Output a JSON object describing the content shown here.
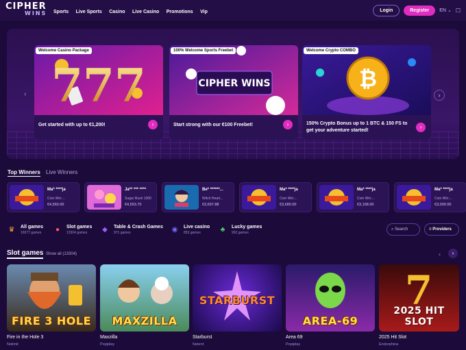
{
  "header": {
    "logo_line1": "CIPHER",
    "logo_line2": "WINS",
    "nav": [
      "Sports",
      "Live Sports",
      "Casino",
      "Live Casino",
      "Promotions",
      "Vip"
    ],
    "login_label": "Login",
    "register_label": "Register",
    "language": "EN",
    "language_caret": "⌄",
    "chat_glyph": "☐"
  },
  "hero": {
    "promos": [
      {
        "tag": "Welcome Casino Package",
        "text": "Get started with up to €1,200!",
        "art_text": "777"
      },
      {
        "tag": "100% Welcome Sports Freebet",
        "text": "Start strong with our €100 Freebet!",
        "art_text": "CIPHER WINS"
      },
      {
        "tag": "Welcome Crypto COMBO",
        "text": "150% Crypto Bonus up to 1 BTC & 150 FS to get your adventure started!",
        "art_text": "₿"
      }
    ],
    "go_glyph": "›",
    "prev_glyph": "‹",
    "next_glyph": "›"
  },
  "winners": {
    "tab_top": "Top Winners",
    "tab_live": "Live Winners",
    "items": [
      {
        "name": "Ma* ****ja",
        "game": "Coin Win:...",
        "amount": "€4,560.00",
        "thumb": "coin"
      },
      {
        "name": "Ja** *** ****",
        "game": "Sugar Rush 1000",
        "amount": "€4,553.70",
        "thumb": "sugar"
      },
      {
        "name": "Be* ******...",
        "game": "Witch Heart...",
        "amount": "€3,697.88",
        "thumb": "witch"
      },
      {
        "name": "Ma* ****ja",
        "game": "Coin Win:...",
        "amount": "€3,680.00",
        "thumb": "coin"
      },
      {
        "name": "Ma* ****ja",
        "game": "Coin Win:...",
        "amount": "€3,168.00",
        "thumb": "coin"
      },
      {
        "name": "Ma* ****ja",
        "game": "Coin Win:...",
        "amount": "€3,000.00",
        "thumb": "coin"
      }
    ]
  },
  "categories": [
    {
      "title": "All games",
      "count": "16077 games",
      "icon": "crown-icon",
      "color": "#f3a53a"
    },
    {
      "title": "Slot games",
      "count": "13304 games",
      "icon": "cherry-icon",
      "color": "#ff5a5a"
    },
    {
      "title": "Table & Crash Games",
      "count": "971 games",
      "icon": "diamond-icon",
      "color": "#9b5cff"
    },
    {
      "title": "Live casino",
      "count": "853 games",
      "icon": "dealer-icon",
      "color": "#7a6cff"
    },
    {
      "title": "Lucky games",
      "count": "902 games",
      "icon": "clover-icon",
      "color": "#4fd36a"
    }
  ],
  "search_label": "Search",
  "providers_label": "Providers",
  "slots": {
    "title": "Slot games",
    "show_all": "Show all (13304)",
    "prev_glyph": "‹",
    "next_glyph": "›",
    "games": [
      {
        "name": "Fire in the Hole 3",
        "provider": "Nolimit",
        "art": "FIRE 3 HOLE"
      },
      {
        "name": "Maxzilla",
        "provider": "Popiplay",
        "art": "MAXZILLA"
      },
      {
        "name": "Starburst",
        "provider": "Netent",
        "art": "STARBURST"
      },
      {
        "name": "Area 69",
        "provider": "Popiplay",
        "art": "AREA-69"
      },
      {
        "name": "2025 Hit Slot",
        "provider": "Endorphina",
        "art": "2025 HIT SLOT"
      }
    ]
  },
  "colors": {
    "accent": "#e02cbf",
    "background": "#1c0b3a"
  }
}
